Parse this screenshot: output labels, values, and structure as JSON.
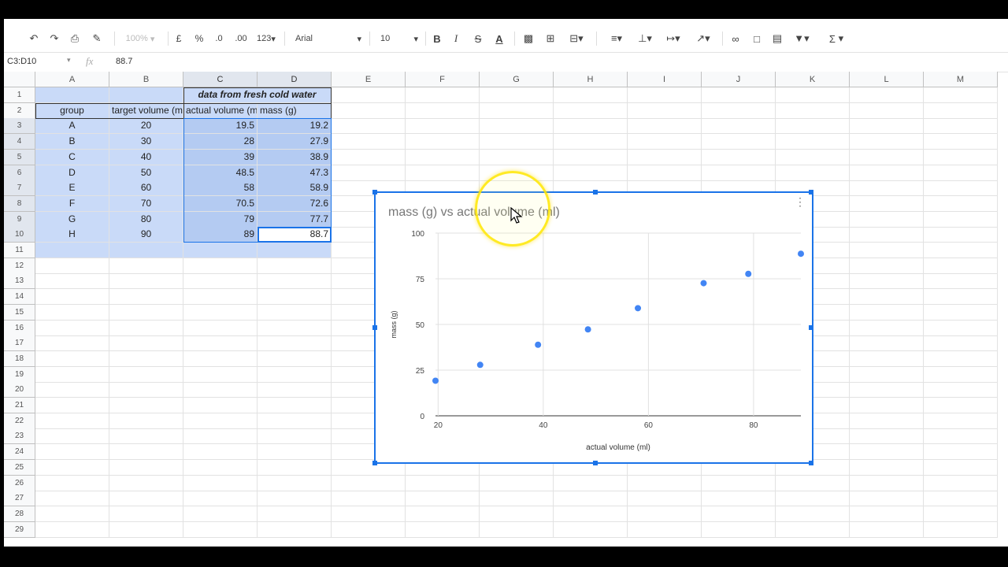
{
  "toolbar": {
    "undo_icon": "undo-icon",
    "redo_icon": "redo-icon",
    "print_icon": "print-icon",
    "paint_format_icon": "paint-format-icon",
    "zoom": "100%",
    "currency": "£",
    "percent": "%",
    "decrease_decimal": ".0",
    "increase_decimal": ".00",
    "more_formats": "123",
    "font": "Arial",
    "font_size": "10",
    "bold": "B",
    "italic": "I",
    "strike": "S",
    "text_color": "A",
    "sum": "Σ"
  },
  "formula_bar": {
    "name_box": "C3:D10",
    "fx": "fx",
    "value": "88.7"
  },
  "columns": [
    "A",
    "B",
    "C",
    "D",
    "E",
    "F",
    "G",
    "H",
    "I",
    "J",
    "K",
    "L",
    "M"
  ],
  "rows": [
    "1",
    "2",
    "3",
    "4",
    "5",
    "6",
    "7",
    "8",
    "9",
    "10",
    "11",
    "12",
    "13",
    "14",
    "15",
    "16",
    "17",
    "18",
    "19",
    "20",
    "21",
    "22",
    "23",
    "24",
    "25",
    "26",
    "27",
    "28",
    "29"
  ],
  "sheet": {
    "title_cell": "data from fresh cold water",
    "headers": [
      "group",
      "target volume (ml)",
      "actual volume (ml)",
      "mass (g)"
    ],
    "groups": [
      "A",
      "B",
      "C",
      "D",
      "E",
      "F",
      "G",
      "H"
    ],
    "target": [
      "20",
      "30",
      "40",
      "50",
      "60",
      "70",
      "80",
      "90"
    ],
    "actual": [
      "19.5",
      "28",
      "39",
      "48.5",
      "58",
      "70.5",
      "79",
      "89"
    ],
    "mass": [
      "19.2",
      "27.9",
      "38.9",
      "47.3",
      "58.9",
      "72.6",
      "77.7",
      "88.7"
    ]
  },
  "chart_data": {
    "type": "scatter",
    "title": "mass (g) vs actual volume (ml)",
    "xlabel": "actual volume (ml)",
    "ylabel": "mass (g)",
    "x": [
      19.5,
      28,
      39,
      48.5,
      58,
      70.5,
      79,
      89
    ],
    "y": [
      19.2,
      27.9,
      38.9,
      47.3,
      58.9,
      72.6,
      77.7,
      88.7
    ],
    "xticks": [
      20,
      40,
      60,
      80
    ],
    "yticks": [
      0,
      25,
      50,
      75,
      100
    ],
    "xlim": [
      19.5,
      89
    ],
    "ylim": [
      0,
      100
    ],
    "grid": true,
    "color": "#4285f4"
  }
}
